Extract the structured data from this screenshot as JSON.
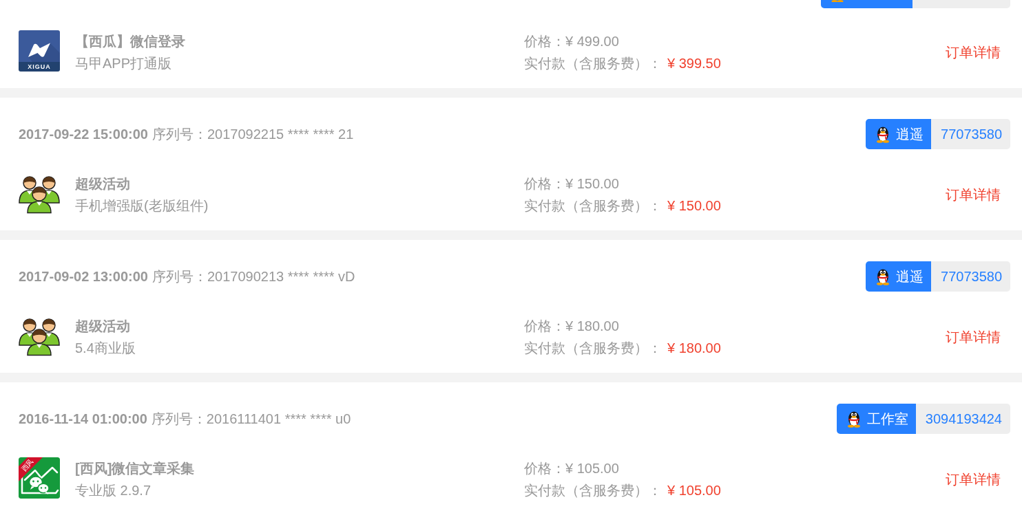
{
  "orders": [
    {
      "header": {
        "kind": "cut"
      },
      "product": {
        "icon": {
          "kind": "lightning",
          "caption": "XIGUA"
        },
        "title": "【西瓜】微信登录",
        "edition": "马甲APP打通版"
      },
      "price_label": "价格：",
      "price": "¥ 499.00",
      "paid_label": "实付款（含服务费）：",
      "paid": "¥ 399.50",
      "action": "订单详情"
    },
    {
      "header": {
        "kind": "full",
        "date": "2017-09-22 15:00:00",
        "serial": "序列号：2017092215 **** **** 21",
        "contact": {
          "name": "逍遥",
          "number": "77073580"
        }
      },
      "product": {
        "icon": {
          "kind": "people"
        },
        "title": "超级活动",
        "edition": "手机增强版(老版组件)"
      },
      "price_label": "价格：",
      "price": "¥ 150.00",
      "paid_label": "实付款（含服务费）：",
      "paid": "¥ 150.00",
      "action": "订单详情"
    },
    {
      "header": {
        "kind": "full",
        "date": "2017-09-02 13:00:00",
        "serial": "序列号：2017090213 **** **** vD",
        "contact": {
          "name": "逍遥",
          "number": "77073580"
        }
      },
      "product": {
        "icon": {
          "kind": "people"
        },
        "title": "超级活动",
        "edition": "5.4商业版"
      },
      "price_label": "价格：",
      "price": "¥ 180.00",
      "paid_label": "实付款（含服务费）：",
      "paid": "¥ 180.00",
      "action": "订单详情"
    },
    {
      "header": {
        "kind": "full",
        "date": "2016-11-14 01:00:00",
        "serial": "序列号：2016111401 **** **** u0",
        "contact": {
          "name": "工作室",
          "number": "3094193424"
        }
      },
      "product": {
        "icon": {
          "kind": "chat-chart",
          "ribbon": "西风"
        },
        "title": "[西风]微信文章采集",
        "edition": "专业版 2.9.7"
      },
      "price_label": "价格：",
      "price": "¥ 105.00",
      "paid_label": "实付款（含服务费）：",
      "paid": "¥ 105.00",
      "action": "订单详情"
    }
  ]
}
